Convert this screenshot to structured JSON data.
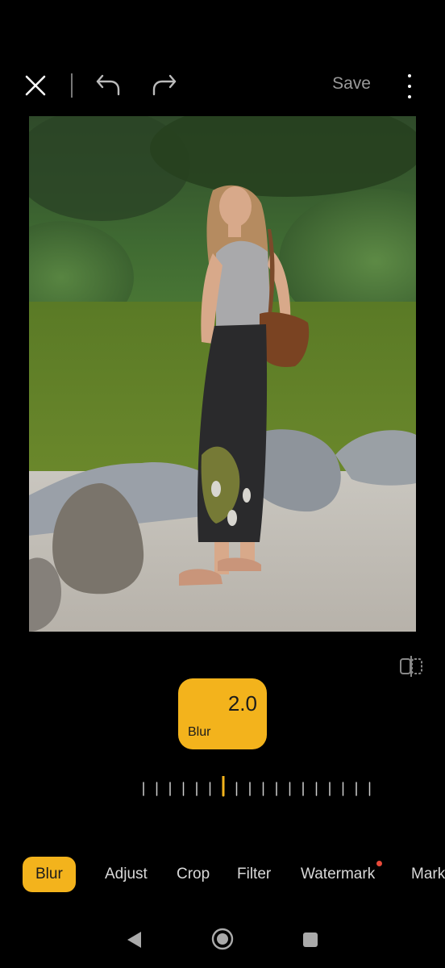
{
  "toolbar": {
    "close_icon": "close-icon",
    "undo_icon": "undo-icon",
    "redo_icon": "redo-icon",
    "save_label": "Save",
    "more_icon": "more-vertical-icon"
  },
  "editor": {
    "compare_icon": "compare-icon",
    "adjustment": {
      "value": "2.0",
      "label": "Blur",
      "accent_color": "#f3b31c"
    }
  },
  "tools": [
    {
      "label": "Blur",
      "active": true
    },
    {
      "label": "Adjust",
      "active": false
    },
    {
      "label": "Crop",
      "active": false
    },
    {
      "label": "Filter",
      "active": false
    },
    {
      "label": "Watermark",
      "active": false,
      "badge": true
    },
    {
      "label": "Mark",
      "active": false
    }
  ],
  "nav": {
    "back_icon": "back-triangle-icon",
    "home_icon": "home-circle-icon",
    "recents_icon": "recents-square-icon"
  }
}
